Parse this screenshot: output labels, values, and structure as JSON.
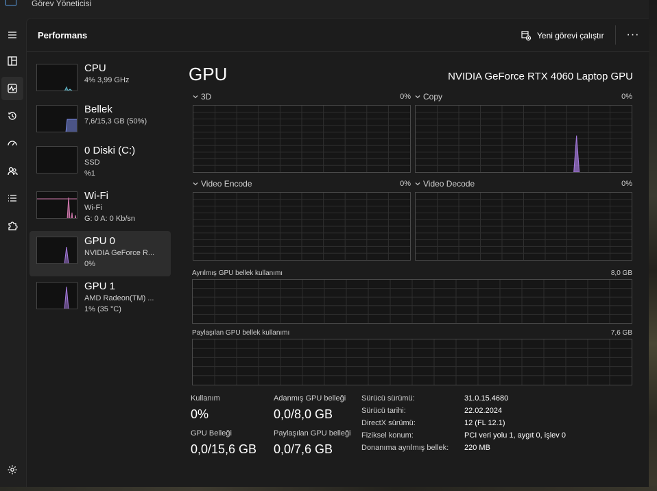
{
  "window": {
    "title": "Görev Yöneticisi"
  },
  "header": {
    "title": "Performans",
    "new_task_label": "Yeni görevi çalıştır",
    "more_label": "···"
  },
  "devices": [
    {
      "name": "CPU",
      "line1": "4% 3,99 GHz",
      "line2": "",
      "color": "#5fb6c8",
      "usage": 0.04
    },
    {
      "name": "Bellek",
      "line1": "7,6/15,3 GB (50%)",
      "line2": "",
      "color": "#7c8ce8",
      "usage": 0.5
    },
    {
      "name": "0 Diski (C:)",
      "line1": "SSD",
      "line2": "%1",
      "color": "#6fbf73",
      "usage": 0.01
    },
    {
      "name": "Wi-Fi",
      "line1": "Wi-Fi",
      "line2": "G: 0 A: 0 Kb/sn",
      "color": "#d47ab0",
      "usage": 0.0
    },
    {
      "name": "GPU 0",
      "line1": "NVIDIA GeForce R...",
      "line2": "0%",
      "color": "#a77be0",
      "usage": 0.0
    },
    {
      "name": "GPU 1",
      "line1": "AMD Radeon(TM) ...",
      "line2": "1% (35 °C)",
      "color": "#a77be0",
      "usage": 0.01
    }
  ],
  "gpu": {
    "title": "GPU",
    "model": "NVIDIA GeForce RTX 4060 Laptop GPU",
    "engines": [
      {
        "label": "3D",
        "pct": "0%"
      },
      {
        "label": "Copy",
        "pct": "0%"
      },
      {
        "label": "Video Encode",
        "pct": "0%"
      },
      {
        "label": "Video Decode",
        "pct": "0%"
      }
    ],
    "dedicated_mem_label": "Ayrılmış GPU bellek kullanımı",
    "dedicated_mem_max": "8,0 GB",
    "shared_mem_label": "Paylaşılan GPU bellek kullanımı",
    "shared_mem_max": "7,6 GB"
  },
  "stats": {
    "usage_label": "Kullanım",
    "usage_value": "0%",
    "gpu_mem_label": "GPU Belleği",
    "gpu_mem_value": "0,0/15,6 GB",
    "dedicated_label": "Adanmış GPU belleği",
    "dedicated_value": "0,0/8,0 GB",
    "shared_label": "Paylaşılan GPU belleği",
    "shared_value": "0,0/7,6 GB"
  },
  "info": [
    {
      "key": "Sürücü sürümü:",
      "value": "31.0.15.4680"
    },
    {
      "key": "Sürücü tarihi:",
      "value": "22.02.2024"
    },
    {
      "key": "DirectX sürümü:",
      "value": "12 (FL 12.1)"
    },
    {
      "key": "Fiziksel konum:",
      "value": "PCI veri yolu 1, aygıt 0, işlev 0"
    },
    {
      "key": "Donanıma ayrılmış bellek:",
      "value": "220 MB"
    }
  ],
  "colors": {
    "gpu_accent": "#a77be0",
    "background": "#202020"
  }
}
